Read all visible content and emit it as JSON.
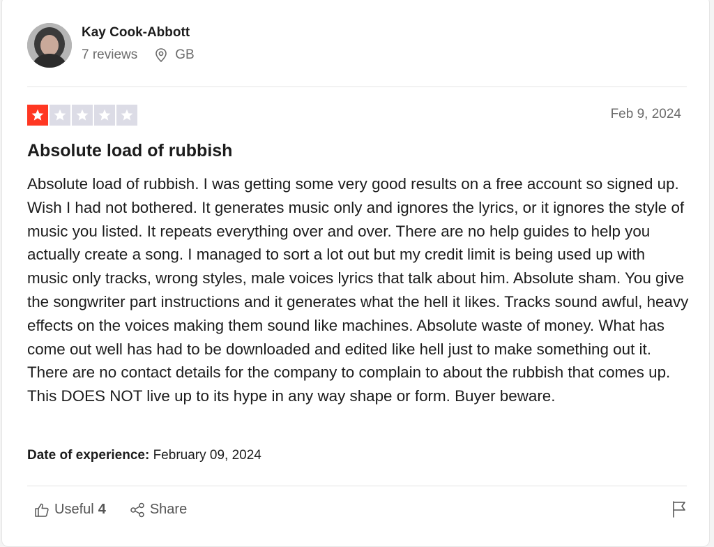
{
  "consumer": {
    "name": "Kay Cook-Abbott",
    "reviews_count": "7 reviews",
    "country": "GB"
  },
  "review": {
    "rating": 1,
    "rating_max": 5,
    "date": "Feb 9, 2024",
    "title": "Absolute load of rubbish",
    "body": "Absolute load of rubbish. I was getting some very good results on a free account so signed up. Wish I had not bothered. It generates music only and ignores the lyrics, or it ignores the style of music you listed. It repeats everything over and over. There are no help guides to help you actually create a song. I managed to sort a lot out but my credit limit is being used up with music only tracks, wrong styles, male voices lyrics that talk about him. Absolute sham. You give the songwriter part instructions and it generates what the hell it likes. Tracks sound awful, heavy effects on the voices making them sound like machines. Absolute waste of money. What has come out well has had to be downloaded and edited like hell just to make something out it. There are no contact details for the company to complain to about the rubbish that comes up. This DOES NOT live up to its hype in any way shape or form. Buyer beware.",
    "experience_label": "Date of experience:",
    "experience_date": "February 09, 2024"
  },
  "actions": {
    "useful_label": "Useful",
    "useful_count": "4",
    "share_label": "Share"
  },
  "icons": {
    "avatar": "avatar-photo",
    "location": "location-pin-icon",
    "star": "star-icon",
    "useful": "thumbs-up-icon",
    "share": "share-icon",
    "report": "flag-icon"
  },
  "colors": {
    "star_filled": "#ff3722",
    "star_empty": "#dcdce6",
    "text": "#1c1c1c",
    "muted": "#6b6b6b"
  }
}
